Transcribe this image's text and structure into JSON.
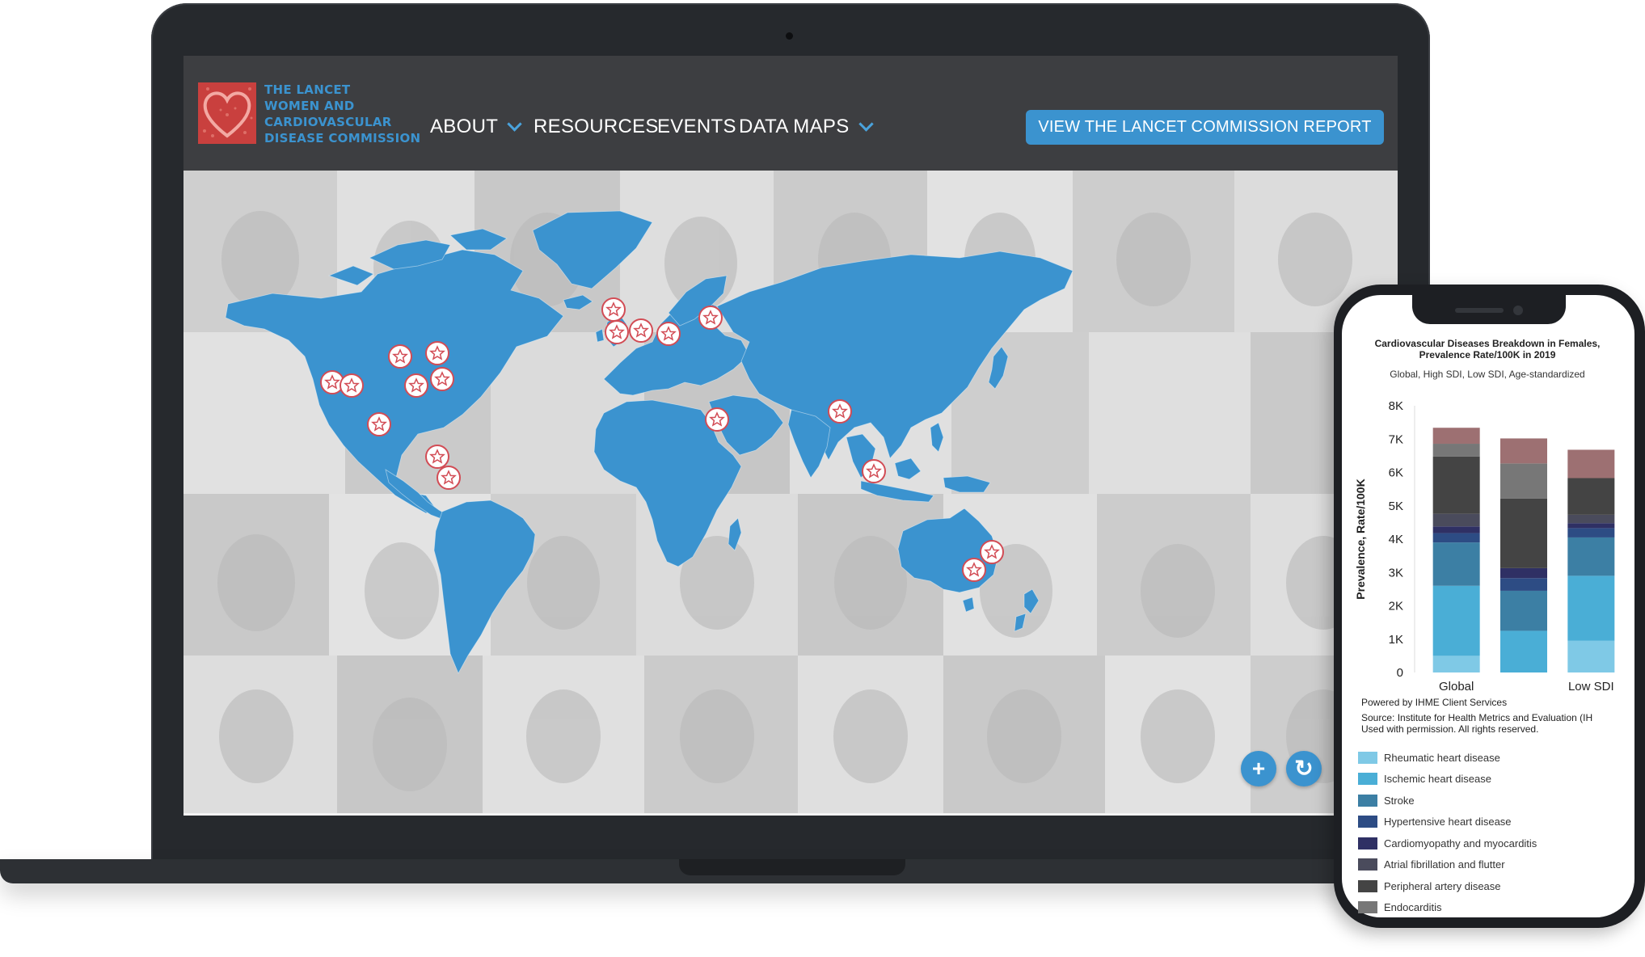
{
  "site": {
    "logo_lines": [
      "The Lancet",
      "Women and",
      "Cardiovascular",
      "Disease Commission"
    ],
    "nav": [
      {
        "label": "ABOUT",
        "has_dropdown": true
      },
      {
        "label": "RESOURCES",
        "has_dropdown": false
      },
      {
        "label": "EVENTS",
        "has_dropdown": false
      },
      {
        "label": "DATA MAPS",
        "has_dropdown": true
      }
    ],
    "cta_label": "VIEW THE LANCET COMMISSION REPORT",
    "colors": {
      "brand_blue": "#3b93cf",
      "nav_bg": "#3d3e41",
      "marker_red": "#d24c55"
    }
  },
  "map": {
    "marker_icon": "star-icon",
    "marker_count": 21,
    "controls": [
      {
        "name": "zoom-in-button",
        "icon": "plus-icon",
        "glyph": "+"
      },
      {
        "name": "reset-button",
        "icon": "refresh-icon",
        "glyph": "↻"
      }
    ]
  },
  "phone": {
    "chart_title": "Cardiovascular Diseases Breakdown in Females, Prevalence Rate/100K in 2019",
    "chart_subtitle": "Global, High SDI, Low SDI, Age-standardized",
    "powered_by": "Powered by IHME Client Services",
    "source_line1": "Source: Institute for Health Metrics and Evaluation (IH",
    "source_line2": "Used with permission. All rights reserved."
  },
  "chart_data": {
    "type": "bar",
    "stacked": true,
    "title": "Cardiovascular Diseases Breakdown in Females, Prevalence Rate/100K in 2019",
    "subtitle": "Global, High SDI, Low SDI, Age-standardized",
    "ylabel": "Prevalence, Rate/100K",
    "xlabel": "",
    "ylim": [
      0,
      8000
    ],
    "yticks": [
      "0",
      "1K",
      "2K",
      "3K",
      "4K",
      "5K",
      "6K",
      "7K",
      "8K"
    ],
    "categories": [
      "Global",
      "",
      "Low SDI"
    ],
    "series": [
      {
        "name": "Rheumatic heart disease",
        "color": "#7fc9e6",
        "values": [
          500,
          0,
          950
        ]
      },
      {
        "name": "Ischemic heart disease",
        "color": "#4aaed6",
        "values": [
          2100,
          1250,
          1950
        ]
      },
      {
        "name": "Stroke",
        "color": "#3c7fa4",
        "values": [
          1300,
          1200,
          1150
        ]
      },
      {
        "name": "Hypertensive heart disease",
        "color": "#2d4c84",
        "values": [
          280,
          380,
          280
        ]
      },
      {
        "name": "Cardiomyopathy and myocarditis",
        "color": "#2f3064",
        "values": [
          200,
          300,
          150
        ]
      },
      {
        "name": "Atrial fibrillation and flutter",
        "color": "#4a4b5c",
        "values": [
          380,
          0,
          250
        ]
      },
      {
        "name": "Peripheral artery disease",
        "color": "#444444",
        "values": [
          1720,
          2090,
          1100
        ]
      },
      {
        "name": "Endocarditis",
        "color": "#777777",
        "values": [
          380,
          1050,
          0
        ]
      },
      {
        "name": "",
        "color": "#9d7072",
        "values": [
          480,
          750,
          850
        ]
      }
    ],
    "legend_visible": [
      "Rheumatic heart disease",
      "Ischemic heart disease",
      "Stroke",
      "Hypertensive heart disease",
      "Cardiomyopathy and myocarditis",
      "Atrial fibrillation and flutter",
      "Peripheral artery disease",
      "Endocarditis"
    ]
  }
}
